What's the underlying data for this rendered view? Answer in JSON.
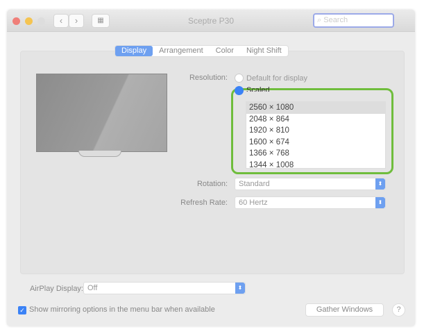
{
  "window": {
    "title": "Sceptre P30",
    "search_placeholder": "Search"
  },
  "tabs": [
    {
      "label": "Display"
    },
    {
      "label": "Arrangement"
    },
    {
      "label": "Color"
    },
    {
      "label": "Night Shift"
    }
  ],
  "resolution": {
    "label": "Resolution:",
    "default_option": "Default for display",
    "scaled_option": "Scaled",
    "options": [
      "2560 × 1080",
      "2048 × 864",
      "1920 × 810",
      "1600 × 674",
      "1366 × 768",
      "1344 × 1008"
    ]
  },
  "rotation": {
    "label": "Rotation:",
    "value": "Standard"
  },
  "refresh": {
    "label": "Refresh Rate:",
    "value": "60 Hertz"
  },
  "airplay": {
    "label": "AirPlay Display:",
    "value": "Off"
  },
  "mirroring": {
    "label": "Show mirroring options in the menu bar when available",
    "checked": true
  },
  "gather_label": "Gather Windows",
  "help_label": "?",
  "colors": {
    "accent": "#6ea0f0",
    "highlight": "#6fbd3c"
  }
}
